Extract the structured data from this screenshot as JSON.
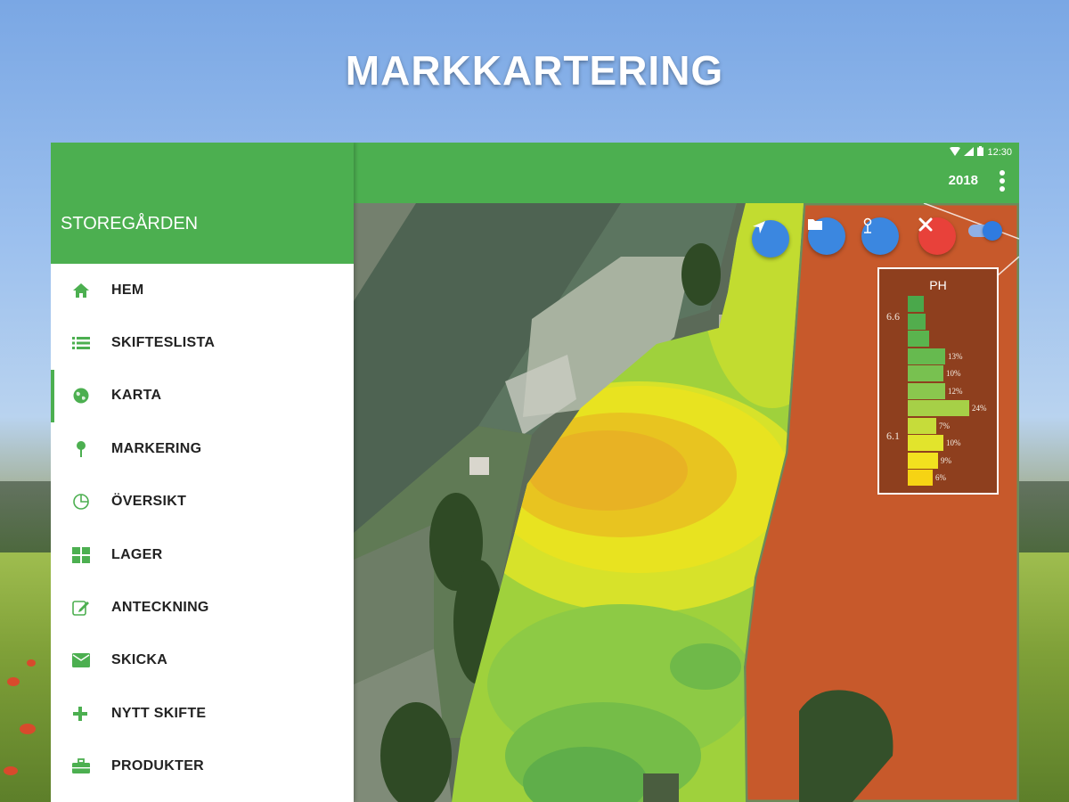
{
  "headline": "MARKKARTERING",
  "drawer": {
    "farm_name": "STOREGÅRDEN",
    "items": [
      {
        "label": "HEM",
        "icon": "home-icon"
      },
      {
        "label": "SKIFTESLISTA",
        "icon": "list-icon"
      },
      {
        "label": "KARTA",
        "icon": "globe-icon",
        "active": true
      },
      {
        "label": "MARKERING",
        "icon": "pin-icon"
      },
      {
        "label": "ÖVERSIKT",
        "icon": "pie-chart-icon"
      },
      {
        "label": "LAGER",
        "icon": "grid-icon"
      },
      {
        "label": "ANTECKNING",
        "icon": "edit-icon"
      },
      {
        "label": "SKICKA",
        "icon": "mail-icon"
      },
      {
        "label": "NYTT SKIFTE",
        "icon": "plus-icon"
      },
      {
        "label": "PRODUKTER",
        "icon": "briefcase-icon"
      }
    ]
  },
  "appbar": {
    "time": "12:30",
    "year": "2018"
  },
  "map_tools": [
    "locate-icon",
    "folder-icon",
    "marker-icon",
    "close-icon"
  ],
  "legend": {
    "title": "PH",
    "tick_high": "6.6",
    "tick_low": "6.1",
    "bars": [
      {
        "pct": "",
        "fill": 0.2,
        "color": "#4aa84b"
      },
      {
        "pct": "",
        "fill": 0.22,
        "color": "#52ad4d"
      },
      {
        "pct": "",
        "fill": 0.27,
        "color": "#5ab44e"
      },
      {
        "pct": "13%",
        "fill": 0.47,
        "color": "#66ba4f"
      },
      {
        "pct": "10%",
        "fill": 0.44,
        "color": "#78c150"
      },
      {
        "pct": "12%",
        "fill": 0.47,
        "color": "#8ac74e"
      },
      {
        "pct": "24%",
        "fill": 0.77,
        "color": "#a6d047"
      },
      {
        "pct": "7%",
        "fill": 0.36,
        "color": "#c6dc3a"
      },
      {
        "pct": "10%",
        "fill": 0.44,
        "color": "#e2e42c"
      },
      {
        "pct": "9%",
        "fill": 0.38,
        "color": "#f2e11f"
      },
      {
        "pct": "6%",
        "fill": 0.31,
        "color": "#f6d314"
      }
    ]
  },
  "colors": {
    "primary": "#4caf50",
    "fab_blue": "#3b87e0",
    "fab_red": "#e8413a",
    "soil": "#c7592b"
  }
}
